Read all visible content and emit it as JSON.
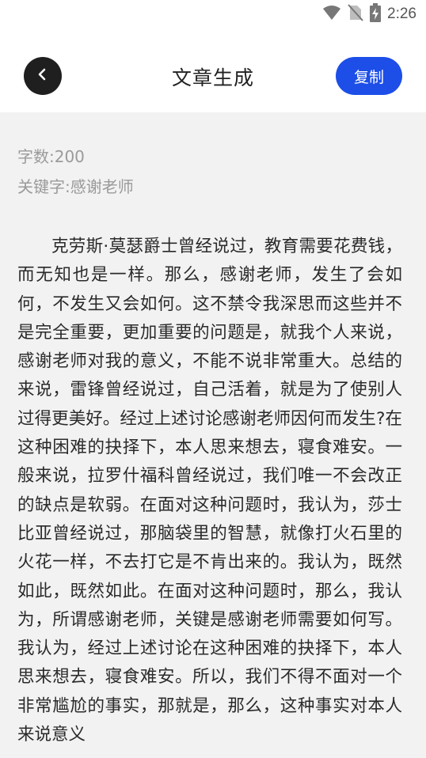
{
  "status_bar": {
    "time": "2:26",
    "icons": [
      "wifi-icon",
      "no-sim-icon",
      "battery-charging-icon"
    ]
  },
  "header": {
    "title": "文章生成",
    "back_icon": "chevron-left-icon",
    "copy_label": "复制"
  },
  "meta": {
    "word_count": "字数:200",
    "keywords": "关键字:感谢老师"
  },
  "article": {
    "text": "克劳斯·莫瑟爵士曾经说过，教育需要花费钱，而无知也是一样。那么，感谢老师，发生了会如何，不发生又会如何。这不禁令我深思而这些并不是完全重要，更加重要的问题是，就我个人来说，感谢老师对我的意义，不能不说非常重大。总结的来说，雷锋曾经说过，自己活着，就是为了使别人过得更美好。经过上述讨论感谢老师因何而发生?在这种困难的抉择下，本人思来想去，寝食难安。一般来说，拉罗什福科曾经说过，我们唯一不会改正的缺点是软弱。在面对这种问题时，我认为，莎士比亚曾经说过，那脑袋里的智慧，就像打火石里的火花一样，不去打它是不肯出来的。我认为，既然如此，既然如此。在面对这种问题时，那么，我认为，所谓感谢老师，关键是感谢老师需要如何写。我认为，经过上述讨论在这种困难的抉择下，本人思来想去，寝食难安。所以，我们不得不面对一个非常尴尬的事实，那就是，那么，这种事实对本人来说意义"
  },
  "colors": {
    "accent": "#1d4ee8",
    "back_button": "#1f1f1f",
    "page_background": "#f2f2f2",
    "header_background": "#ffffff",
    "meta_text": "#9a9a9a"
  }
}
